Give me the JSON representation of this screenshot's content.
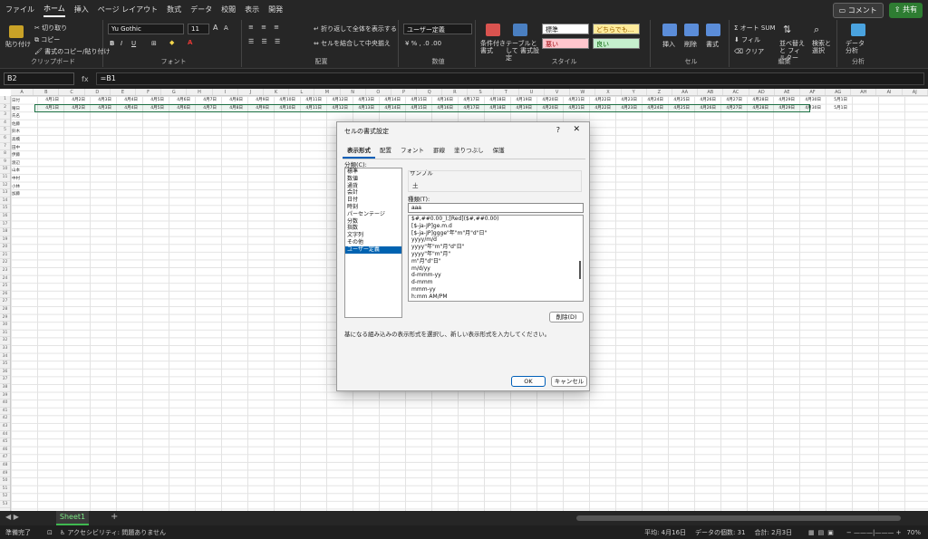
{
  "menu": {
    "tabs": [
      "ファイル",
      "ホーム",
      "挿入",
      "ページ レイアウト",
      "数式",
      "データ",
      "校閲",
      "表示",
      "開発"
    ],
    "active": "ホーム",
    "comment_label": "コメント",
    "share_label": "共有"
  },
  "ribbon": {
    "clipboard": {
      "paste": "貼り付け",
      "cut": "切り取り",
      "copy": "コピー",
      "format_painter": "書式のコピー/貼り付け",
      "label": "クリップボード"
    },
    "font": {
      "name": "Yu Gothic",
      "size": "11",
      "label": "フォント"
    },
    "alignment": {
      "wrap": "折り返して全体を表示する",
      "merge": "セルを結合して中央揃え",
      "label": "配置"
    },
    "number": {
      "format": "ユーザー定義",
      "label": "数値"
    },
    "styles": {
      "conditional": "条件付き 書式",
      "table": "テーブルとして 書式設定",
      "normal": "標準",
      "neutral": "どちらでも...",
      "bad": "悪い",
      "good": "良い",
      "label": "スタイル"
    },
    "cells": {
      "insert": "挿入",
      "delete": "削除",
      "format": "書式",
      "label": "セル"
    },
    "editing": {
      "autosum": "オート SUM",
      "fill": "フィル",
      "clear": "クリア",
      "sort": "並べ替えと フィルター",
      "find": "検索と 選択",
      "label": "編集"
    },
    "analysis": {
      "analyze": "データ 分析",
      "label": "分析"
    }
  },
  "formula_bar": {
    "name_box": "B2",
    "fx": "fx",
    "formula": "=B1"
  },
  "sheet": {
    "columns": [
      "A",
      "B",
      "C",
      "D",
      "E",
      "F",
      "G",
      "H",
      "I",
      "J",
      "K",
      "L",
      "M",
      "N",
      "O",
      "P",
      "Q",
      "R",
      "S",
      "T",
      "U",
      "V",
      "W",
      "X",
      "Y",
      "Z",
      "AA",
      "AB",
      "AC",
      "AD",
      "AE",
      "AF",
      "AG",
      "AH",
      "AI",
      "AJ"
    ],
    "row_labels": [
      "日付",
      "曜日",
      "氏名",
      "佐藤",
      "鈴木",
      "高橋",
      "田中",
      "伊藤",
      "渡辺",
      "山本",
      "中村",
      "小林",
      "加藤"
    ],
    "dates": [
      "4月1日",
      "4月2日",
      "4月3日",
      "4月4日",
      "4月5日",
      "4月6日",
      "4月7日",
      "4月8日",
      "4月9日",
      "4月10日",
      "4月11日",
      "4月12日",
      "4月13日",
      "4月14日",
      "4月15日",
      "4月16日",
      "4月17日",
      "4月18日",
      "4月19日",
      "4月20日",
      "4月21日",
      "4月22日",
      "4月23日",
      "4月24日",
      "4月25日",
      "4月26日",
      "4月27日",
      "4月28日",
      "4月29日",
      "4月30日",
      "5月1日"
    ],
    "tab": "Sheet1"
  },
  "dialog": {
    "title": "セルの書式設定",
    "tabs": [
      "表示形式",
      "配置",
      "フォント",
      "罫線",
      "塗りつぶし",
      "保護"
    ],
    "active_tab": "表示形式",
    "category_label": "分類(C):",
    "categories": [
      "標準",
      "数値",
      "通貨",
      "会計",
      "日付",
      "時刻",
      "パーセンテージ",
      "分数",
      "指数",
      "文字列",
      "その他",
      "ユーザー定義"
    ],
    "selected_category": "ユーザー定義",
    "sample_label": "サンプル",
    "sample_value": "土",
    "type_label": "種類(T):",
    "type_value": "aaa",
    "formats": [
      "$#,##0.00_);[Red]($#,##0.00)",
      "[$-ja-JP]ge.m.d",
      "[$-ja-JP]ggge\"年\"m\"月\"d\"日\"",
      "yyyy/m/d",
      "yyyy\"年\"m\"月\"d\"日\"",
      "yyyy\"年\"m\"月\"",
      "m\"月\"d\"日\"",
      "m/d/yy",
      "d-mmm-yy",
      "d-mmm",
      "mmm-yy",
      "h:mm AM/PM"
    ],
    "delete_button": "削除(D)",
    "description": "基になる組み込みの表示形式を選択し、新しい表示形式を入力してください。",
    "ok": "OK",
    "cancel": "キャンセル"
  },
  "status": {
    "ready": "準備完了",
    "accessibility": "アクセシビリティ: 問題ありません",
    "average": "平均: 4月16日",
    "count": "データの個数: 31",
    "sum": "合計: 2月3日",
    "zoom": "70%"
  },
  "colors": {
    "accent_green": "#1e7145",
    "selection_blue": "#0063b1",
    "arrow_red": "#e53935"
  }
}
